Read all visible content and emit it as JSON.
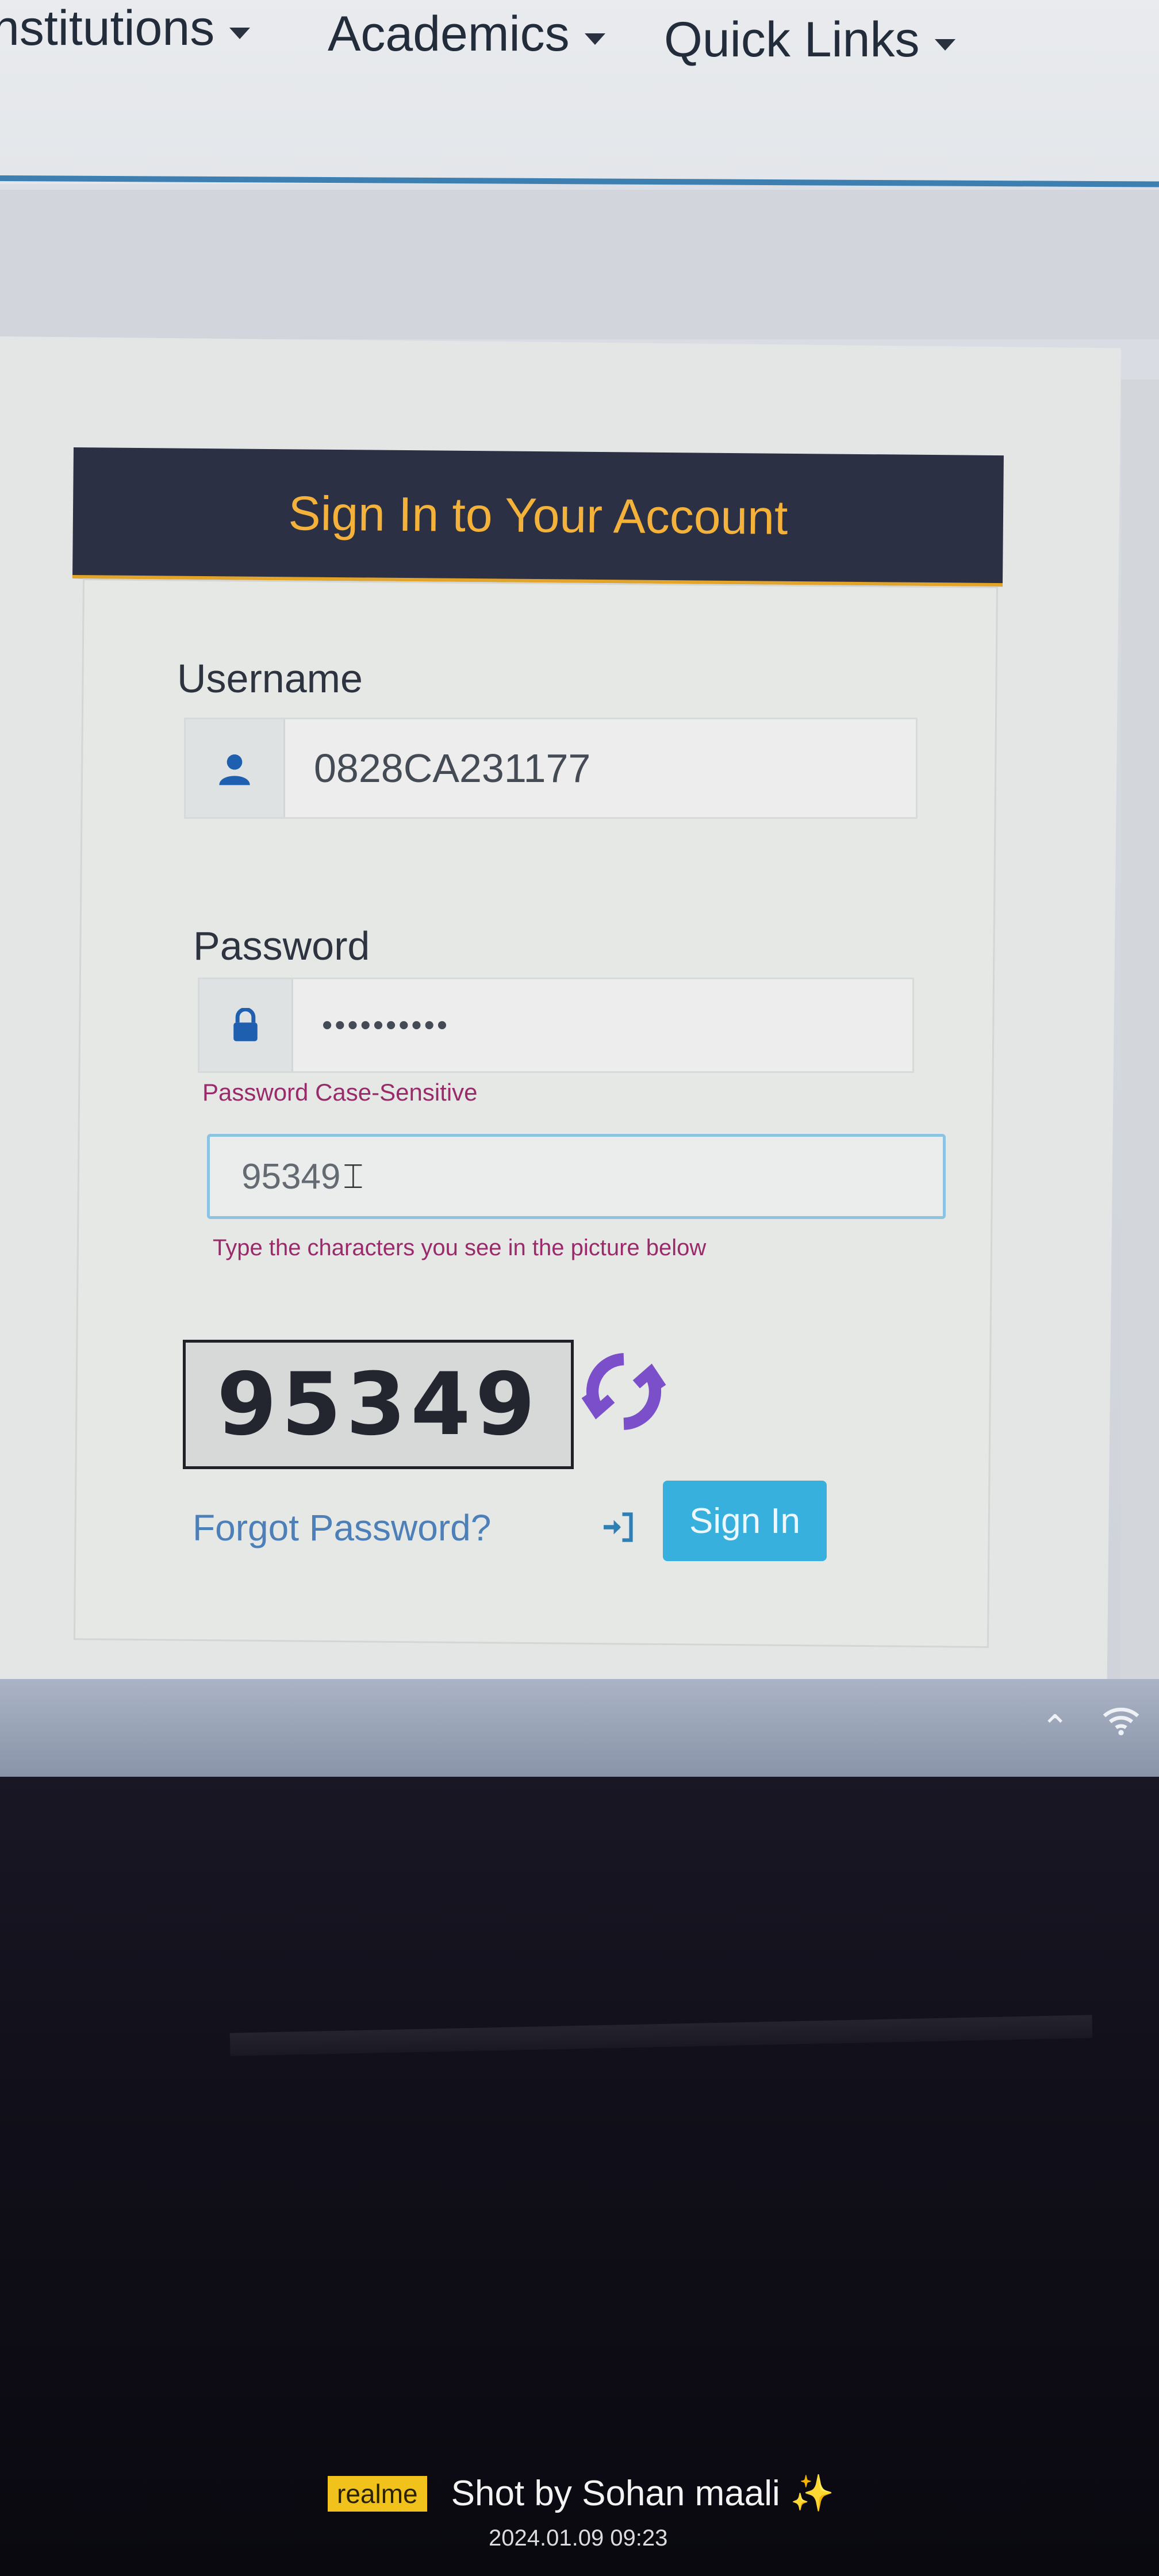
{
  "nav": {
    "items": [
      {
        "label": "nstitutions"
      },
      {
        "label": "Academics"
      },
      {
        "label": "Quick Links"
      }
    ]
  },
  "login": {
    "title": "Sign In to Your Account",
    "username_label": "Username",
    "username_value": "0828CA231177",
    "password_label": "Password",
    "password_value": "••••••••••",
    "password_hint": "Password Case-Sensitive",
    "captcha_input_value": "95349",
    "captcha_hint": "Type the characters you see in the picture below",
    "captcha_image_text": "95349",
    "forgot_label": "Forgot Password?",
    "signin_label": "Sign In"
  },
  "icons": {
    "user": "user-icon",
    "lock": "lock-icon",
    "refresh": "refresh-icon",
    "signin": "sign-in-icon",
    "caret": "caret-down-icon",
    "tray_up": "chevron-up-icon",
    "wifi": "wifi-icon"
  },
  "colors": {
    "header_bg": "#2c3045",
    "header_text": "#f4b23a",
    "button_bg": "#37b0de",
    "hint_text": "#9a2b6b",
    "link": "#4d7fb8"
  },
  "watermark": {
    "brand": "realme",
    "text": "Shot by Sohan maali ✨",
    "date": "2024.01.09 09:23"
  }
}
